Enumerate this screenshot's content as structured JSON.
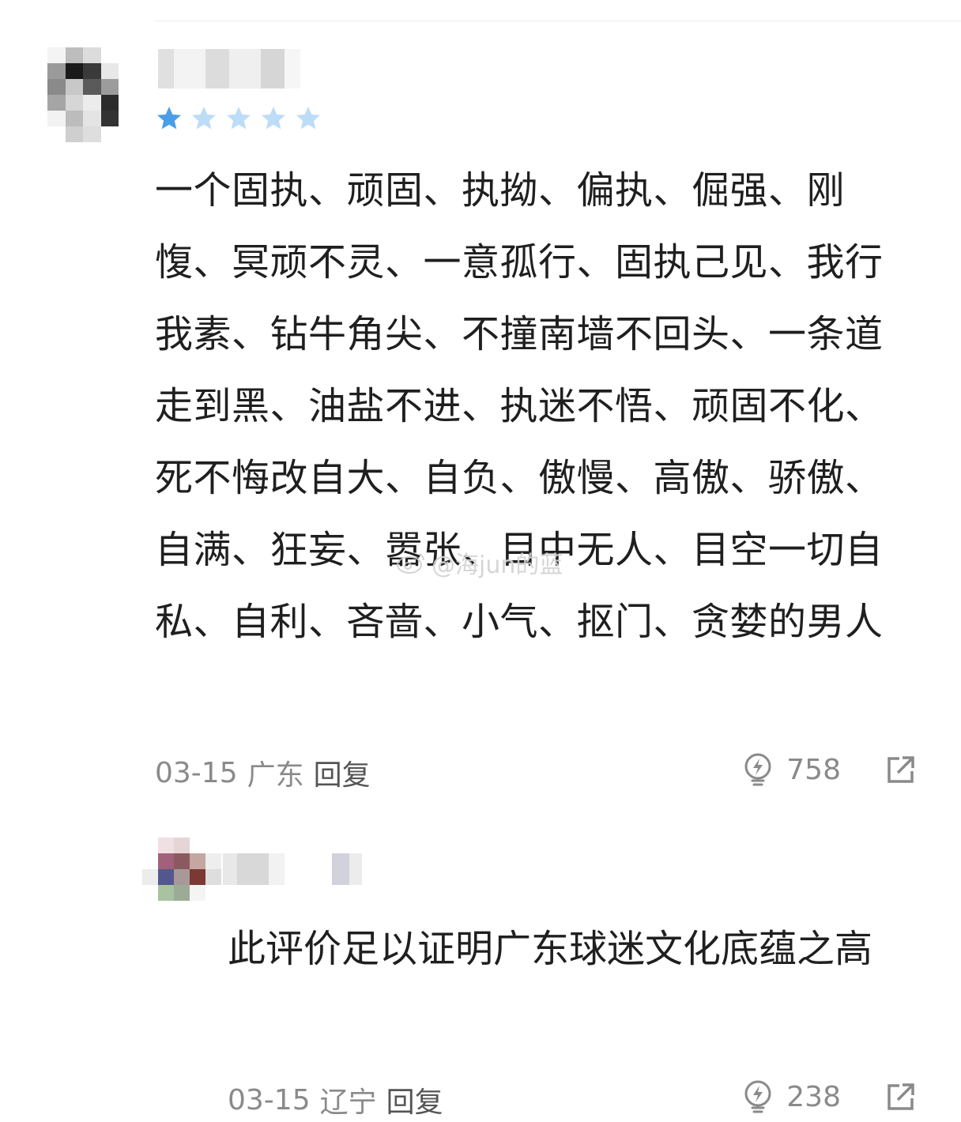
{
  "comment": {
    "rating": 1,
    "rating_max": 5,
    "text": "一个固执、顽固、执拗、偏执、倔强、刚愎、冥顽不灵、一意孤行、固执己见、我行我素、钻牛角尖、不撞南墙不回头、一条道走到黑、油盐不进、执迷不悟、顽固不化、死不悔改自大、自负、傲慢、高傲、骄傲、自满、狂妄、嚣张、目中无人、目空一切自私、自利、吝啬、小气、抠门、贪婪的男人",
    "date": "03-15",
    "location": "广东",
    "reply_label": "回复",
    "likes": "758"
  },
  "reply": {
    "text": "此评价足以证明广东球迷文化底蕴之高",
    "date": "03-15",
    "location": "辽宁",
    "reply_label": "回复",
    "likes": "238"
  },
  "watermark": {
    "text": "@海jun的蓝"
  },
  "icons": {
    "star_filled": "star-filled-icon",
    "star_empty": "star-empty-icon",
    "like": "lightning-bulb-icon",
    "share": "share-icon",
    "weibo": "weibo-icon"
  },
  "colors": {
    "star_filled": "#4a9ee8",
    "star_empty": "#bddcf6",
    "meta_text": "#8a8a8a",
    "body_text": "#1f1f1f"
  }
}
